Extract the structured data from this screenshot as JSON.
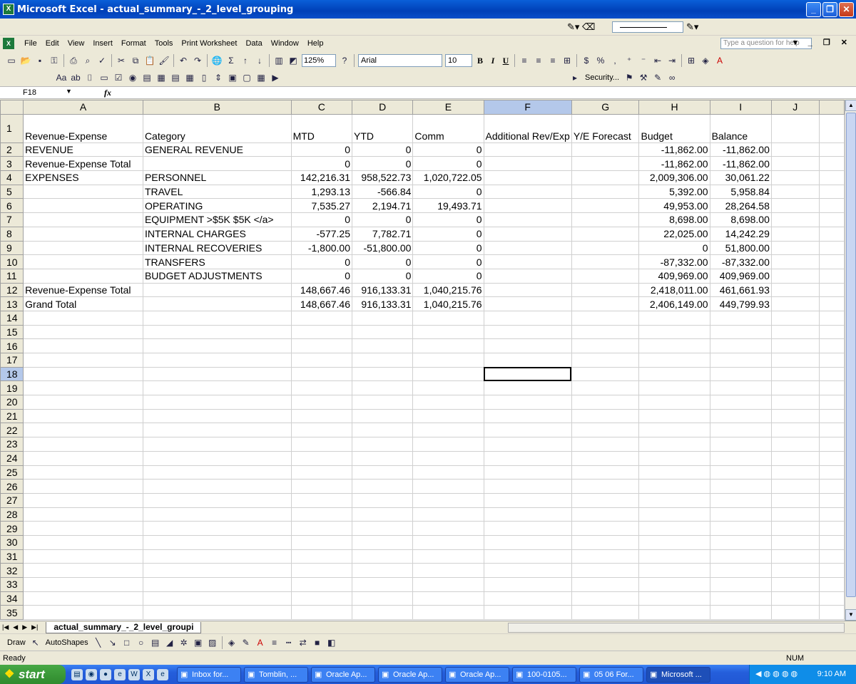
{
  "window": {
    "title": "Microsoft Excel - actual_summary_-_2_level_grouping"
  },
  "menu": [
    "File",
    "Edit",
    "View",
    "Insert",
    "Format",
    "Tools",
    "Print Worksheet",
    "Data",
    "Window",
    "Help"
  ],
  "help_placeholder": "Type a question for help",
  "toolbar": {
    "zoom": "125%",
    "font": "Arial",
    "font_size": "10",
    "security_label": "Security..."
  },
  "formula_bar": {
    "name_box": "F18",
    "fx": "fx",
    "content": ""
  },
  "columns": [
    "A",
    "B",
    "C",
    "D",
    "E",
    "F",
    "G",
    "H",
    "I",
    "J"
  ],
  "selected_column": "F",
  "header_row": [
    "Revenue-Expense",
    "Category",
    "MTD",
    "YTD",
    "Comm",
    "Additional Rev/Exp",
    "Y/E Forecast",
    "Budget",
    "Balance",
    ""
  ],
  "rows": [
    [
      "REVENUE",
      "GENERAL REVENUE",
      "0",
      "0",
      "0",
      "",
      "",
      "-11,862.00",
      "-11,862.00",
      ""
    ],
    [
      "Revenue-Expense Total",
      "",
      "0",
      "0",
      "0",
      "",
      "",
      "-11,862.00",
      "-11,862.00",
      ""
    ],
    [
      "EXPENSES",
      "PERSONNEL",
      "142,216.31",
      "958,522.73",
      "1,020,722.05",
      "",
      "",
      "2,009,306.00",
      "30,061.22",
      ""
    ],
    [
      "",
      "TRAVEL",
      "1,293.13",
      "-566.84",
      "0",
      "",
      "",
      "5,392.00",
      "5,958.84",
      ""
    ],
    [
      "",
      "OPERATING",
      "7,535.27",
      "2,194.71",
      "19,493.71",
      "",
      "",
      "49,953.00",
      "28,264.58",
      ""
    ],
    [
      "",
      "EQUIPMENT >$5K $5K </a>",
      "0",
      "0",
      "0",
      "",
      "",
      "8,698.00",
      "8,698.00",
      ""
    ],
    [
      "",
      "INTERNAL CHARGES",
      "-577.25",
      "7,782.71",
      "0",
      "",
      "",
      "22,025.00",
      "14,242.29",
      ""
    ],
    [
      "",
      "INTERNAL RECOVERIES",
      "-1,800.00",
      "-51,800.00",
      "0",
      "",
      "",
      "0",
      "51,800.00",
      ""
    ],
    [
      "",
      "TRANSFERS",
      "0",
      "0",
      "0",
      "",
      "",
      "-87,332.00",
      "-87,332.00",
      ""
    ],
    [
      "",
      "BUDGET ADJUSTMENTS",
      "0",
      "0",
      "0",
      "",
      "",
      "409,969.00",
      "409,969.00",
      ""
    ],
    [
      "Revenue-Expense Total",
      "",
      "148,667.46",
      "916,133.31",
      "1,040,215.76",
      "",
      "",
      "2,418,011.00",
      "461,661.93",
      ""
    ],
    [
      "Grand Total",
      "",
      "148,667.46",
      "916,133.31",
      "1,040,215.76",
      "",
      "",
      "2,406,149.00",
      "449,799.93",
      ""
    ]
  ],
  "empty_row_start": 14,
  "empty_row_end": 35,
  "active_cell": "F18",
  "sheet_tab": "actual_summary_-_2_level_groupi",
  "draw_bar": {
    "draw": "Draw",
    "autoshapes": "AutoShapes"
  },
  "status": {
    "left": "Ready",
    "right": "NUM"
  },
  "taskbar": {
    "start": "start",
    "tasks": [
      "Inbox for...",
      "Tomblin, ...",
      "Oracle Ap...",
      "Oracle Ap...",
      "Oracle Ap...",
      "100-0105...",
      "05 06 For...",
      "Microsoft ..."
    ],
    "active_task": 7,
    "clock": "9:10 AM"
  }
}
